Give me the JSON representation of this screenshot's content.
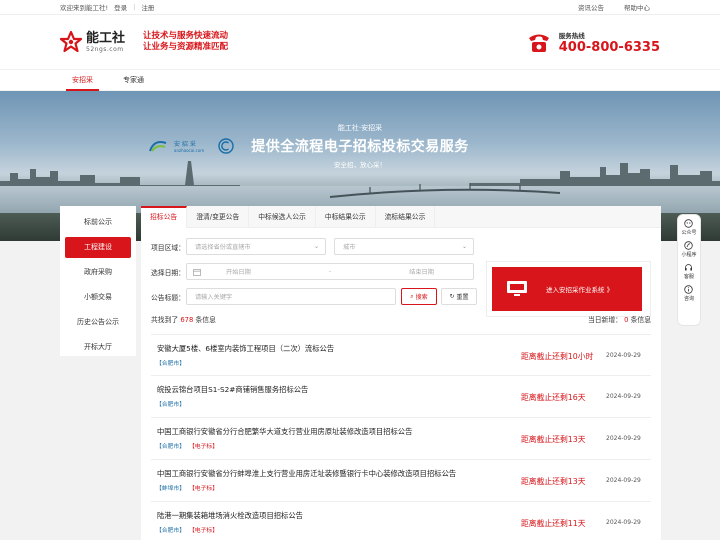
{
  "topbar": {
    "welcome": "欢迎来到能工社!",
    "login": "登录",
    "sep": "|",
    "register": "注册",
    "news": "资讯公告",
    "help": "帮助中心"
  },
  "header": {
    "brand_name": "能工社",
    "brand_domain": "52ngs.com",
    "slogan1": "让技术与服务快速流动",
    "slogan2": "让业务与资源精准匹配",
    "hotline_label": "服务热线",
    "hotline_number": "400-800-6335"
  },
  "nav": {
    "tabs": [
      "安招采",
      "专家通"
    ]
  },
  "banner": {
    "small_title": "能工社·安招采",
    "main_title": "提供全流程电子招标投标交易服务",
    "subtitle": "安全招，放心采！",
    "partner_name": "安 招 采",
    "partner_sub": "anzhaocai.com"
  },
  "sidebar": {
    "items": [
      "标前公示",
      "工程建设",
      "政府采购",
      "小额交易",
      "历史公告公示",
      "开标大厅"
    ]
  },
  "main": {
    "tabs": [
      "招标公告",
      "澄清/变更公告",
      "中标候选人公示",
      "中标结果公示",
      "流标结果公示"
    ],
    "filter": {
      "region_label": "项目区域：",
      "province_placeholder": "请选择省份或直辖市",
      "city_placeholder": "城市",
      "date_label": "选择日期：",
      "start_placeholder": "开始日期",
      "date_sep": "-",
      "end_placeholder": "结束日期",
      "keyword_label": "公告标题：",
      "keyword_placeholder": "请输入关键字",
      "search_btn": "搜索",
      "reset_btn": "重置"
    },
    "cta": "进入安招采作业系统 》",
    "summary": {
      "found_prefix": "共找到了",
      "count": "678",
      "found_suffix": "条信息",
      "today_prefix": "当日新增：",
      "today_count": "0",
      "today_suffix": "条信息"
    },
    "rows": [
      {
        "title": "安徽大厦5楼、6楼室内装饰工程项目（二次）流标公告",
        "tags": [
          "【合肥市】"
        ],
        "countdown": "距离截止还剩10小时",
        "date": "2024-09-29"
      },
      {
        "title": "皖投云锦台项目S1-S2#商铺销售服务招标公告",
        "tags": [
          "【合肥市】"
        ],
        "countdown": "距离截止还剩16天",
        "date": "2024-09-29"
      },
      {
        "title": "中国工商银行安徽省分行合肥繁华大道支行营业用房原址装修改造项目招标公告",
        "tags": [
          "【合肥市】",
          "【电子标】"
        ],
        "countdown": "距离截止还剩13天",
        "date": "2024-09-29"
      },
      {
        "title": "中国工商银行安徽省分行蚌埠淮上支行营业用房迁址装修暨银行卡中心装修改造项目招标公告",
        "tags": [
          "【蚌埠市】",
          "【电子标】"
        ],
        "countdown": "距离截止还剩13天",
        "date": "2024-09-29"
      },
      {
        "title": "陆港一期集装箱堆场消火栓改造项目招标公告",
        "tags": [
          "【合肥市】",
          "【电子标】"
        ],
        "countdown": "距离截止还剩11天",
        "date": "2024-09-29"
      }
    ]
  },
  "float": {
    "items": [
      "公众号",
      "小程序",
      "客服",
      "咨询"
    ]
  },
  "colors": {
    "brand_red": "#d7151a",
    "tag_blue": "#1a6ea8"
  }
}
